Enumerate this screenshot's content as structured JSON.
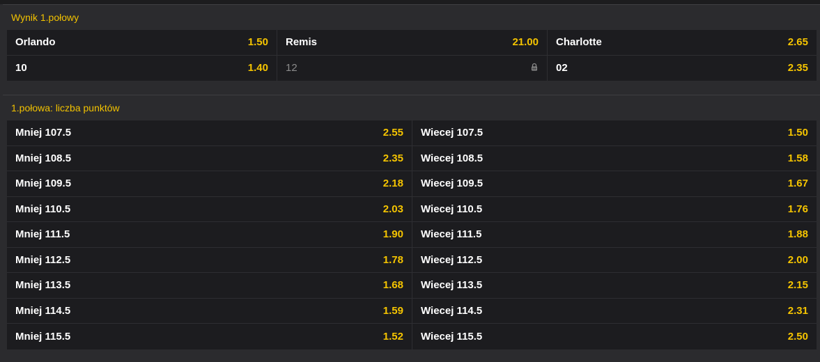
{
  "colors": {
    "accent": "#f5c400",
    "background": "#2b2b2e",
    "cell": "#1c1c1f"
  },
  "sections": [
    {
      "title": "Wynik 1.połowy",
      "rows": [
        [
          {
            "label": "Orlando",
            "odd": "1.50"
          },
          {
            "label": "Remis",
            "odd": "21.00"
          },
          {
            "label": "Charlotte",
            "odd": "2.65"
          }
        ],
        [
          {
            "label": "10",
            "odd": "1.40"
          },
          {
            "label": "12",
            "odd": "",
            "locked": true,
            "icon": "lock-icon"
          },
          {
            "label": "02",
            "odd": "2.35"
          }
        ]
      ]
    },
    {
      "title": "1.połowa: liczba punktów",
      "rows": [
        [
          {
            "label": "Mniej 107.5",
            "odd": "2.55"
          },
          {
            "label": "Wiecej 107.5",
            "odd": "1.50"
          }
        ],
        [
          {
            "label": "Mniej 108.5",
            "odd": "2.35"
          },
          {
            "label": "Wiecej 108.5",
            "odd": "1.58"
          }
        ],
        [
          {
            "label": "Mniej 109.5",
            "odd": "2.18"
          },
          {
            "label": "Wiecej 109.5",
            "odd": "1.67"
          }
        ],
        [
          {
            "label": "Mniej 110.5",
            "odd": "2.03"
          },
          {
            "label": "Wiecej 110.5",
            "odd": "1.76"
          }
        ],
        [
          {
            "label": "Mniej 111.5",
            "odd": "1.90"
          },
          {
            "label": "Wiecej 111.5",
            "odd": "1.88"
          }
        ],
        [
          {
            "label": "Mniej 112.5",
            "odd": "1.78"
          },
          {
            "label": "Wiecej 112.5",
            "odd": "2.00"
          }
        ],
        [
          {
            "label": "Mniej 113.5",
            "odd": "1.68"
          },
          {
            "label": "Wiecej 113.5",
            "odd": "2.15"
          }
        ],
        [
          {
            "label": "Mniej 114.5",
            "odd": "1.59"
          },
          {
            "label": "Wiecej 114.5",
            "odd": "2.31"
          }
        ],
        [
          {
            "label": "Mniej 115.5",
            "odd": "1.52"
          },
          {
            "label": "Wiecej 115.5",
            "odd": "2.50"
          }
        ]
      ]
    }
  ]
}
